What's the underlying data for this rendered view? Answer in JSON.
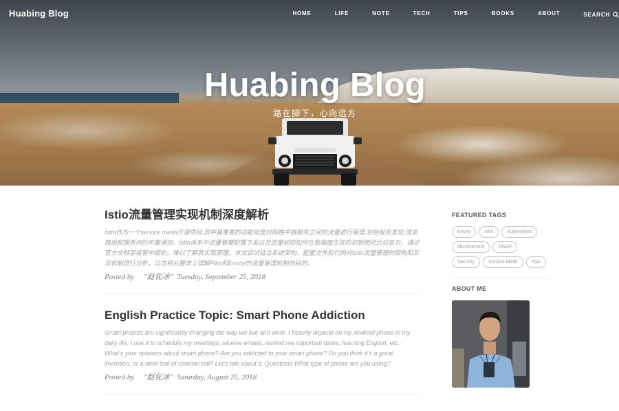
{
  "header": {
    "brand": "Huabing Blog",
    "nav": [
      {
        "label": "HOME"
      },
      {
        "label": "LIFE"
      },
      {
        "label": "NOTE"
      },
      {
        "label": "TECH"
      },
      {
        "label": "TIPS"
      },
      {
        "label": "BOOKS"
      },
      {
        "label": "ABOUT"
      },
      {
        "label": "SEARCH",
        "icon": "search-icon"
      }
    ]
  },
  "hero": {
    "title": "Huabing Blog",
    "subtitle": "路在脚下，心向远方"
  },
  "posts": [
    {
      "title": "Istio流量管理实现机制深度解析",
      "excerpt": "Istio作为一个service mesh开源项目,其中最重要的功能就是对网格中微服务之间的流量进行管理,包括服务发现,请求路由和服务间的可靠通信。Istio体系中流量管理配置下发以及流量规则如何在数据面生效的机制相对比较复杂，通过官方文档容易管中窥豹，难以了解其实现原理。本文尝试结合系统架构、配置文件和代码对Istio流量管理的架构和实现机制进行分析，以达到从整体上理解Pilot和Envoy的流量管理机制的目的。",
      "posted_by": "Posted by",
      "author": "\"赵化冰\"",
      "date": "Tuesday, September 25, 2018"
    },
    {
      "title": "English Practice Topic: Smart Phone Addiction",
      "excerpt": "Smart phones are significantly changing the way we live and work. I heavily depend on my Android phone in my daily life, I use it to schedule my meetings, receive emails, remind me important dates, learning English, etc. What's your opinions about smart phone? Are you addicted to your smart phone? Do you think it's a great invention, or a devil tool of commercial? Let's talk about it. Questions What type of phone are you using?",
      "posted_by": "Posted by",
      "author": "\"赵化冰\"",
      "date": "Saturday, August 25, 2018"
    }
  ],
  "sidebar": {
    "featured_tags_heading": "FEATURED TAGS",
    "tags": [
      {
        "label": "Envoy"
      },
      {
        "label": "Istio"
      },
      {
        "label": "Kubernetes"
      },
      {
        "label": "Microservice"
      },
      {
        "label": "ONAP"
      },
      {
        "label": "Security"
      },
      {
        "label": "Service Mesh"
      },
      {
        "label": "Tips"
      }
    ],
    "about_heading": "ABOUT ME"
  }
}
